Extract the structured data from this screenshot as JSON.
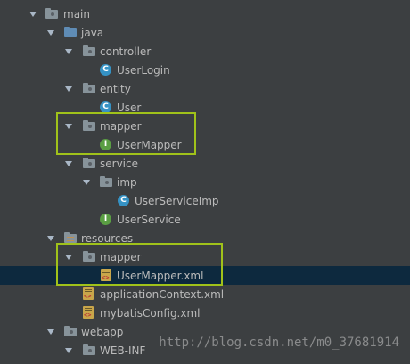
{
  "tree": {
    "main": "main",
    "java": "java",
    "controller": "controller",
    "user_login": "UserLogin",
    "entity": "entity",
    "user": "User",
    "mapper_pkg": "mapper",
    "user_mapper": "UserMapper",
    "service": "service",
    "imp": "imp",
    "user_service_imp": "UserServiceImp",
    "user_service": "UserService",
    "resources": "resources",
    "mapper_res": "mapper",
    "user_mapper_xml": "UserMapper.xml",
    "application_context": "applicationContext.xml",
    "mybatis_config": "mybatisConfig.xml",
    "webapp": "webapp",
    "web_inf": "WEB-INF"
  },
  "badges": {
    "class": "C",
    "interface": "I"
  },
  "watermark": "http://blog.csdn.net/m0_37681914",
  "colors": {
    "background": "#3c3f41",
    "selected_row": "#0d293e",
    "highlight_box": "#a0c21a"
  }
}
